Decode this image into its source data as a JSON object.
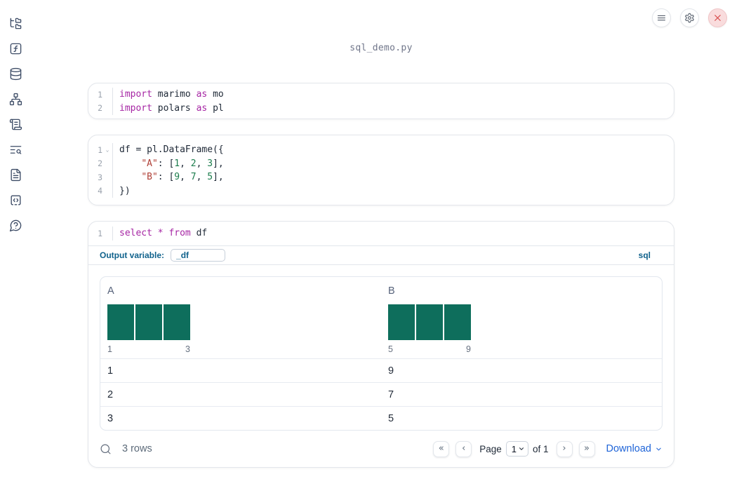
{
  "app": {
    "filename": "sql_demo.py"
  },
  "topbar": {
    "buttons": [
      {
        "name": "menu"
      },
      {
        "name": "settings"
      },
      {
        "name": "close"
      }
    ]
  },
  "sidebar": {
    "items": [
      {
        "name": "file-explorer"
      },
      {
        "name": "variables"
      },
      {
        "name": "data-sources"
      },
      {
        "name": "dependency-graph"
      },
      {
        "name": "logs"
      },
      {
        "name": "scratchpad-search"
      },
      {
        "name": "documentation"
      },
      {
        "name": "snippets"
      },
      {
        "name": "help"
      }
    ]
  },
  "cells": [
    {
      "lines": [
        {
          "num": "1",
          "tokens": [
            {
              "text": "import",
              "type": "kw"
            },
            {
              "text": " marimo ",
              "type": "plain"
            },
            {
              "text": "as",
              "type": "kw"
            },
            {
              "text": " mo",
              "type": "plain"
            }
          ]
        },
        {
          "num": "2",
          "tokens": [
            {
              "text": "import",
              "type": "kw"
            },
            {
              "text": " polars ",
              "type": "plain"
            },
            {
              "text": "as",
              "type": "kw"
            },
            {
              "text": " pl",
              "type": "plain"
            }
          ]
        }
      ]
    },
    {
      "lines": [
        {
          "num": "1",
          "fold": "⌄",
          "tokens": [
            {
              "text": "df = pl.DataFrame({",
              "type": "plain"
            }
          ]
        },
        {
          "num": "2",
          "tokens": [
            {
              "text": "    ",
              "type": "plain"
            },
            {
              "text": "\"A\"",
              "type": "str"
            },
            {
              "text": ": [",
              "type": "plain"
            },
            {
              "text": "1",
              "type": "num"
            },
            {
              "text": ", ",
              "type": "plain"
            },
            {
              "text": "2",
              "type": "num"
            },
            {
              "text": ", ",
              "type": "plain"
            },
            {
              "text": "3",
              "type": "num"
            },
            {
              "text": "],",
              "type": "plain"
            }
          ]
        },
        {
          "num": "3",
          "tokens": [
            {
              "text": "    ",
              "type": "plain"
            },
            {
              "text": "\"B\"",
              "type": "str"
            },
            {
              "text": ": [",
              "type": "plain"
            },
            {
              "text": "9",
              "type": "num"
            },
            {
              "text": ", ",
              "type": "plain"
            },
            {
              "text": "7",
              "type": "num"
            },
            {
              "text": ", ",
              "type": "plain"
            },
            {
              "text": "5",
              "type": "num"
            },
            {
              "text": "],",
              "type": "plain"
            }
          ]
        },
        {
          "num": "4",
          "tokens": [
            {
              "text": "})",
              "type": "plain"
            }
          ]
        }
      ]
    },
    {
      "lines": [
        {
          "num": "1",
          "tokens": [
            {
              "text": "select",
              "type": "kw"
            },
            {
              "text": " ",
              "type": "plain"
            },
            {
              "text": "*",
              "type": "kw"
            },
            {
              "text": " ",
              "type": "plain"
            },
            {
              "text": "from",
              "type": "kw"
            },
            {
              "text": " df",
              "type": "plain"
            }
          ]
        }
      ]
    }
  ],
  "sql_cell": {
    "output_variable_label": "Output variable:",
    "output_variable_value": "_df",
    "language_badge": "sql"
  },
  "table": {
    "columns": [
      {
        "label": "A",
        "hist": {
          "bars": [
            1,
            1,
            1
          ],
          "min_label": "1",
          "max_label": "3"
        }
      },
      {
        "label": "B",
        "hist": {
          "bars": [
            1,
            1,
            1
          ],
          "min_label": "5",
          "max_label": "9"
        }
      }
    ],
    "rows": [
      [
        "1",
        "9"
      ],
      [
        "2",
        "7"
      ],
      [
        "3",
        "5"
      ]
    ],
    "footer": {
      "rows_count": "3 rows",
      "first_page": "«",
      "prev_page": "‹",
      "page_label": "Page",
      "page_value": "1",
      "of_label": "of 1",
      "next_page": "›",
      "last_page": "»",
      "download_label": "Download"
    }
  },
  "colors": {
    "keyword": "#a626a4",
    "string": "#b04138",
    "number": "#1c7d4d",
    "sql_accent": "#10628c",
    "histogram_bar": "#0e6e5c",
    "download_link": "#2065d8",
    "close_button": "#d64545"
  }
}
